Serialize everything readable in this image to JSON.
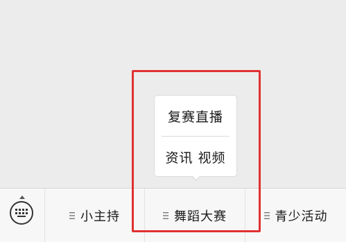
{
  "menu_bar": {
    "keyboard_icon": "keyboard-icon",
    "items": [
      {
        "label": "小主持",
        "icon": "list-lines-icon"
      },
      {
        "label": "舞蹈大赛",
        "icon": "list-lines-icon"
      },
      {
        "label": "青少活动",
        "icon": "list-lines-icon"
      }
    ]
  },
  "submenu": {
    "items": [
      {
        "label": "复赛直播"
      },
      {
        "label": "资讯 视频"
      }
    ]
  },
  "colors": {
    "highlight": "#e03131",
    "background": "#ececec",
    "menu_bar": "#f7f7f7"
  }
}
